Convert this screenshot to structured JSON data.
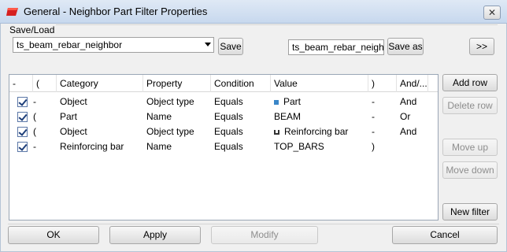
{
  "window": {
    "title": "General - Neighbor Part Filter Properties",
    "close_label": "✕"
  },
  "saveload": {
    "label": "Save/Load",
    "selected": "ts_beam_rebar_neighbor",
    "save_label": "Save",
    "save_as_value": "ts_beam_rebar_neighbor",
    "save_as_label": "Save as",
    "expand_label": ">>"
  },
  "grid": {
    "headers": [
      "-",
      "(",
      "Category",
      "Property",
      "Condition",
      "Value",
      ")",
      "And/..."
    ],
    "rows": [
      {
        "checked": true,
        "dash": "-",
        "open": "",
        "category": "Object",
        "property": "Object type",
        "condition": "Equals",
        "icon": "part-icon",
        "value": "Part",
        "close": "-",
        "andor": "And"
      },
      {
        "checked": true,
        "dash": "(",
        "open": "",
        "category": "Part",
        "property": "Name",
        "condition": "Equals",
        "icon": "",
        "value": "BEAM",
        "close": "-",
        "andor": "Or"
      },
      {
        "checked": true,
        "dash": "(",
        "open": "",
        "category": "Object",
        "property": "Object type",
        "condition": "Equals",
        "icon": "reinforcing-bar-icon",
        "value": "Reinforcing bar",
        "close": "-",
        "andor": "And"
      },
      {
        "checked": true,
        "dash": "-",
        "open": "",
        "category": "Reinforcing bar",
        "property": "Name",
        "condition": "Equals",
        "icon": "",
        "value": "TOP_BARS",
        "close": ")",
        "andor": ""
      }
    ]
  },
  "side_buttons": {
    "add_row": "Add row",
    "delete_row": "Delete row",
    "move_up": "Move up",
    "move_down": "Move down",
    "new_filter": "New filter"
  },
  "footer": {
    "ok": "OK",
    "apply": "Apply",
    "modify": "Modify",
    "cancel": "Cancel"
  },
  "colors": {
    "titlebar": "#c7d8ee",
    "part_icon": "#3a86c8",
    "check": "#1e3f7a"
  }
}
